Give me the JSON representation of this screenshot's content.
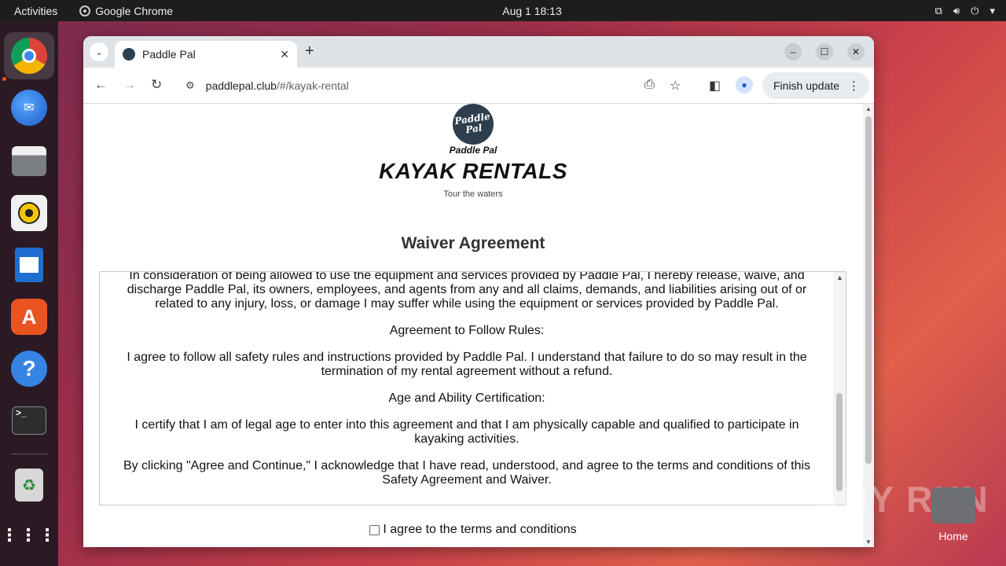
{
  "topbar": {
    "activities": "Activities",
    "app_name": "Google Chrome",
    "clock": "Aug 1  18:13"
  },
  "dock": {
    "items": [
      "chrome-icon",
      "thunderbird-icon",
      "files-icon",
      "rhythmbox-icon",
      "writer-icon",
      "app-center-icon",
      "help-icon",
      "terminal-icon",
      "trash-icon",
      "apps-grid-icon"
    ]
  },
  "browser": {
    "tab_title": "Paddle Pal",
    "url_host": "paddlepal.club",
    "url_path": "/#/kayak-rental",
    "finish_update": "Finish update"
  },
  "page": {
    "logo_line1": "Paddle",
    "logo_line2": "Pal",
    "logo_caption": "Paddle Pal",
    "title": "KAYAK RENTALS",
    "subtitle": "Tour the waters",
    "waiver_heading": "Waiver Agreement",
    "waiver_paragraphs": [
      "In consideration of being allowed to use the equipment and services provided by Paddle Pal, I hereby release, waive, and discharge Paddle Pal, its owners, employees, and agents from any and all claims, demands, and liabilities arising out of or related to any injury, loss, or damage I may suffer while using the equipment or services provided by Paddle Pal.",
      "Agreement to Follow Rules:",
      "I agree to follow all safety rules and instructions provided by Paddle Pal. I understand that failure to do so may result in the termination of my rental agreement without a refund.",
      "Age and Ability Certification:",
      "I certify that I am of legal age to enter into this agreement and that I am physically capable and qualified to participate in kayaking activities.",
      "By clicking \"Agree and Continue,\" I acknowledge that I have read, understood, and agree to the terms and conditions of this Safety Agreement and Waiver."
    ],
    "agree_label": "I agree to the terms and conditions"
  },
  "desktop": {
    "home_label": "Home",
    "watermark": "ANY RUN"
  }
}
